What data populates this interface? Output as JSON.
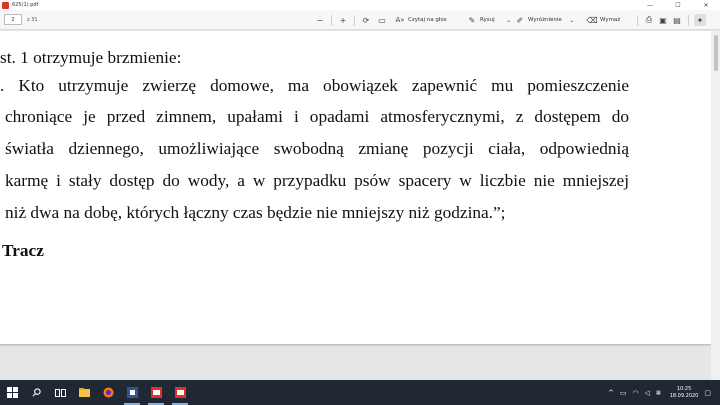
{
  "window": {
    "title": "625(1).pdf"
  },
  "toolbar": {
    "page_current": "2",
    "page_total": "z 31",
    "read_aloud": "Czytaj na głos",
    "draw": "Rysuj",
    "highlight": "Wyróżnienie",
    "erase": "Wymaż"
  },
  "document": {
    "lines": [
      "st. 1 otrzymuje brzmienie:",
      ". Kto utrzymuje zwierzę domowe, ma obowiązek zapewnić mu pomieszczenie",
      "chroniące je przed zimnem, upałami i opadami atmosferycznymi, z dostępem do",
      "światła dziennego, umożliwiające swobodną zmianę pozycji ciała, odpowiednią",
      "karmę i stały dostęp do wody, a w przypadku psów spacery w liczbie nie mniejszej",
      "niż dwa na dobę, których łączny czas będzie nie mniejszy niż godzina.”;"
    ],
    "signature": "Tracz"
  },
  "taskbar": {
    "time": "10:25",
    "date": "18.09.2020"
  },
  "colors": {
    "taskbar": "#1f2833",
    "pdf_red": "#d9342b"
  }
}
